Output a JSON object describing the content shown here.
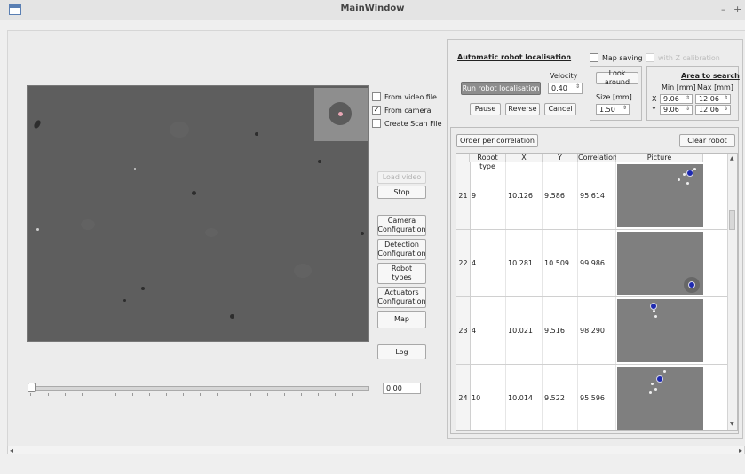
{
  "window": {
    "title": "MainWindow",
    "minimize": "–",
    "maximize": "+"
  },
  "source": {
    "from_video_file": "From video file",
    "from_camera": "From camera",
    "create_scan_file": "Create Scan File",
    "from_camera_checked": true
  },
  "side_buttons": {
    "load_video": "Load video",
    "stop": "Stop",
    "camera_config": "Camera\nConfiguration",
    "detection_config": "Detection\nConfiguration",
    "robot_types": "Robot\ntypes",
    "actuators_config": "Actuators\nConfiguration",
    "map": "Map",
    "log": "Log"
  },
  "slider": {
    "value_text": "0.00",
    "position": 0.0
  },
  "localisation": {
    "title": "Automatic robot localisation",
    "map_saving": "Map saving",
    "with_z": "with Z calibration",
    "velocity_label": "Velocity",
    "velocity_value": "0.40",
    "run_button": "Run robot localisation",
    "look_around": "Look around",
    "size_label": "Size [mm]",
    "size_value": "1.50",
    "pause": "Pause",
    "reverse": "Reverse",
    "cancel": "Cancel",
    "area_title": "Area to search",
    "min_label": "Min [mm]",
    "max_label": "Max [mm]",
    "x_label": "X",
    "y_label": "Y",
    "x_min": "9.06",
    "x_max": "12.06",
    "y_min": "9.06",
    "y_max": "12.06"
  },
  "table": {
    "order_button": "Order per correlation",
    "clear_button": "Clear robot",
    "headers": [
      "Robot type",
      "X",
      "Y",
      "Correlation",
      "Picture"
    ],
    "rows": [
      {
        "num": "21",
        "type": "9",
        "x": "10.126",
        "y": "9.586",
        "corr": "95.614"
      },
      {
        "num": "22",
        "type": "4",
        "x": "10.281",
        "y": "10.509",
        "corr": "99.986"
      },
      {
        "num": "23",
        "type": "4",
        "x": "10.021",
        "y": "9.516",
        "corr": "98.290"
      },
      {
        "num": "24",
        "type": "10",
        "x": "10.014",
        "y": "9.522",
        "corr": "95.596"
      }
    ]
  },
  "icons": {
    "spin_up": "▲",
    "spin_down": "▼",
    "scroll_left": "◂",
    "scroll_right": "▸",
    "check": "✓"
  }
}
